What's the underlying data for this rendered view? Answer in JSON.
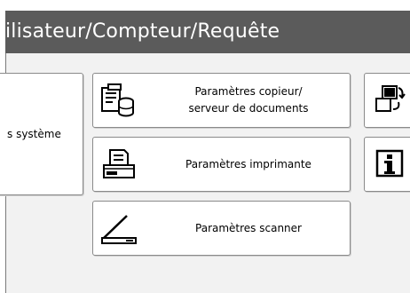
{
  "header": {
    "title": "ilisateur/Compteur/Requête"
  },
  "buttons": {
    "system": {
      "label": "s système"
    },
    "copier": {
      "line1": "Paramètres copieur/",
      "line2": "serveur de documents"
    },
    "printer": {
      "label": "Paramètres imprimante"
    },
    "scanner": {
      "label": "Paramètres scanner"
    }
  },
  "icons": {
    "copier": "copier-document-server-icon",
    "printer": "printer-icon",
    "scanner": "scanner-icon",
    "switch": "screen-switch-icon",
    "info": "info-icon"
  },
  "colors": {
    "title_bar": "#5b5b5b",
    "panel": "#f2f2f2",
    "button": "#ffffff"
  }
}
